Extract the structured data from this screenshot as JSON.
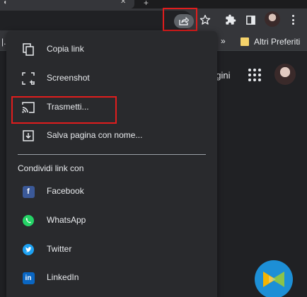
{
  "toolbar": {
    "share_icon": "share-icon",
    "bookmark_icon": "star-icon",
    "extensions_icon": "puzzle-icon",
    "side_panel_icon": "side-panel-icon",
    "menu_icon": "more-vert-icon"
  },
  "bookmarks_bar": {
    "left_fragment": "|.",
    "overflow": "»",
    "other_bookmarks": "Altri Preferiti"
  },
  "page": {
    "partial_text": "agini"
  },
  "share_menu": {
    "items": [
      {
        "label": "Copia link",
        "icon": "copy-icon"
      },
      {
        "label": "Screenshot",
        "icon": "screenshot-icon"
      },
      {
        "label": "Trasmetti...",
        "icon": "cast-icon"
      },
      {
        "label": "Salva pagina con nome...",
        "icon": "download-icon"
      }
    ],
    "section_title": "Condividi link con",
    "services": [
      {
        "label": "Facebook",
        "icon": "facebook-icon",
        "color": "#3b5998"
      },
      {
        "label": "WhatsApp",
        "icon": "whatsapp-icon",
        "color": "#25d366"
      },
      {
        "label": "Twitter",
        "icon": "twitter-icon",
        "color": "#1da1f2"
      },
      {
        "label": "LinkedIn",
        "icon": "linkedin-icon",
        "color": "#0a66c2"
      }
    ]
  },
  "colors": {
    "highlight": "#e01d1d",
    "menu_bg": "#292a2d",
    "toolbar_bg": "#35363a"
  }
}
